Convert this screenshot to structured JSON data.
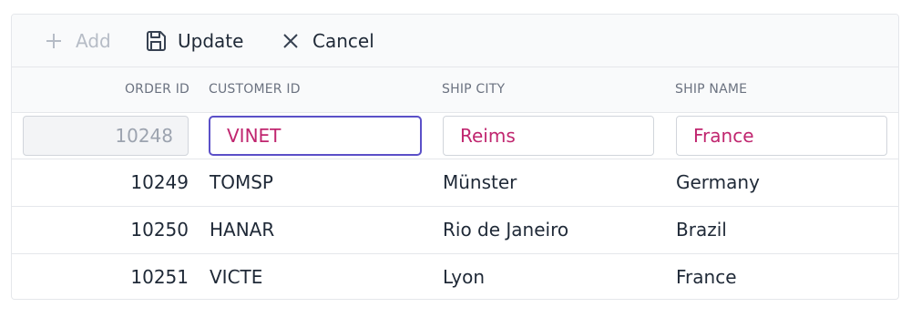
{
  "toolbar": {
    "add_label": "Add",
    "update_label": "Update",
    "cancel_label": "Cancel"
  },
  "columns": [
    "ORDER ID",
    "CUSTOMER ID",
    "SHIP CITY",
    "SHIP NAME"
  ],
  "edit_row": {
    "order_id": "10248",
    "customer_id": "VINET",
    "ship_city": "Reims",
    "ship_name": "France"
  },
  "rows": [
    {
      "order_id": "10249",
      "customer_id": "TOMSP",
      "ship_city": "Münster",
      "ship_name": "Germany"
    },
    {
      "order_id": "10250",
      "customer_id": "HANAR",
      "ship_city": "Rio de Janeiro",
      "ship_name": "Brazil"
    },
    {
      "order_id": "10251",
      "customer_id": "VICTE",
      "ship_city": "Lyon",
      "ship_name": "France"
    }
  ],
  "colors": {
    "accent": "#5b50c8",
    "edit_text": "#c0266f",
    "header_bg": "#f9fafb"
  },
  "icons": {
    "add": "plus-icon",
    "update": "save-icon",
    "cancel": "close-icon"
  }
}
